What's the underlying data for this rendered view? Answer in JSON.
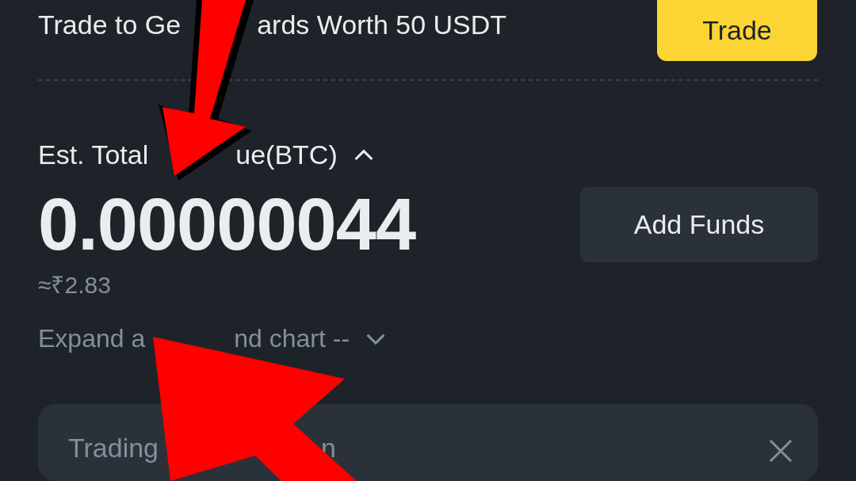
{
  "promo": {
    "text_parts": [
      "Trade to Ge",
      "ards Worth 50 USDT"
    ],
    "button": "Trade"
  },
  "balance": {
    "label_parts": [
      "Est. Total",
      "ue(BTC)"
    ],
    "expanded": true,
    "value": "0.00000044",
    "fiat": "≈₹2.83",
    "button": "Add Funds"
  },
  "chart_toggle": {
    "text_parts": [
      "Expand a",
      "nd chart --"
    ],
    "expanded": false
  },
  "notice": {
    "title_parts": [
      "Trading",
      "n"
    ]
  }
}
